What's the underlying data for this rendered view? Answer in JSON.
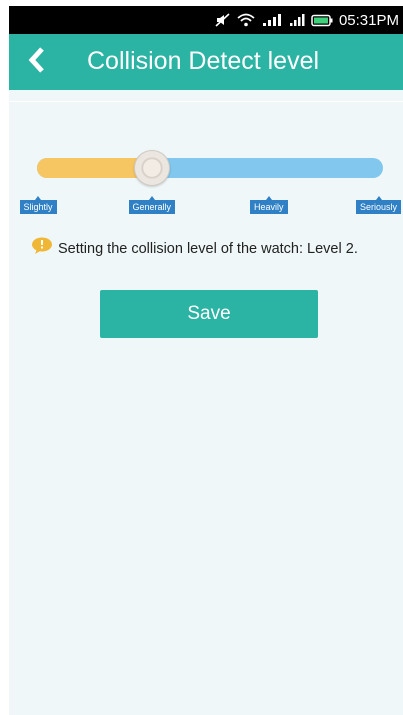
{
  "status_bar": {
    "time": "05:31PM",
    "icons": [
      "mute-icon",
      "wifi-icon",
      "mobile-data-icon",
      "signal-icon",
      "battery-icon"
    ]
  },
  "header": {
    "title": "Collision Detect level",
    "back_icon": "chevron-left-icon"
  },
  "slider": {
    "levels": [
      "Slightly",
      "Generally",
      "Heavily",
      "Seriously"
    ],
    "current_level": 2,
    "colors": {
      "filled": "#f6c663",
      "unfilled": "#82c7ee",
      "label_bg": "#2f80c5"
    }
  },
  "hint": {
    "icon": "speech-bubble-icon",
    "text": "Setting the collision level of the watch: Level 2."
  },
  "save_button": {
    "label": "Save"
  },
  "colors": {
    "accent": "#2bb3a3",
    "background": "#eff7f8"
  }
}
